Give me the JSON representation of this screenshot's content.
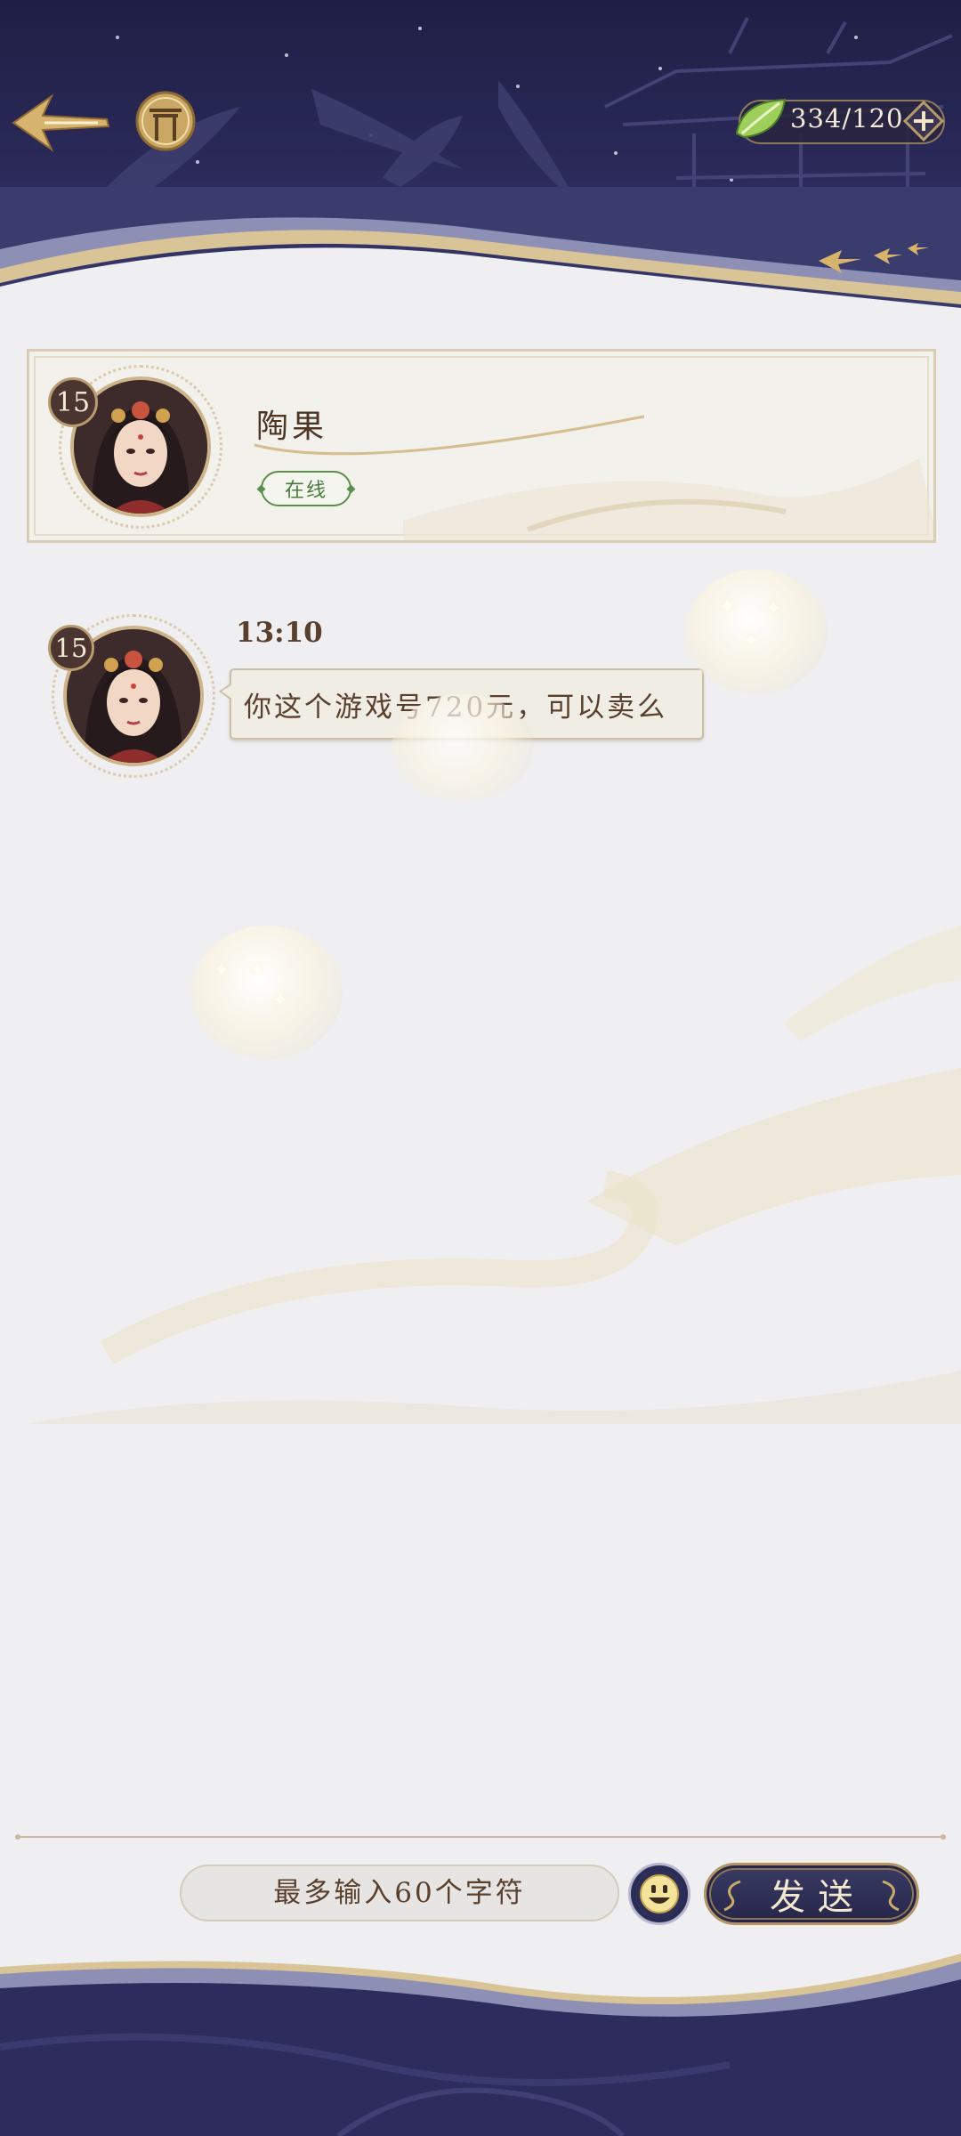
{
  "header": {
    "currency": {
      "icon": "leaf-icon",
      "value": "334/120",
      "add_icon": "plus-icon"
    },
    "back_icon": "back-arrow-icon",
    "gate_icon": "gate-icon"
  },
  "contact": {
    "name": "陶果",
    "status": "在线",
    "level": "15"
  },
  "messages": [
    {
      "time": "13:10",
      "level": "15",
      "text": "你这个游戏号720元，可以卖么"
    }
  ],
  "input": {
    "placeholder": "最多输入60个字符",
    "value": ""
  },
  "actions": {
    "emoji_icon": "smile-emoji-icon",
    "send_label": "发送"
  },
  "colors": {
    "banner_dark": "#2b2a5a",
    "gold": "#c9a96a",
    "online_green": "#4b7a3c",
    "text_brown": "#5a3f2c",
    "background": "#efeff1"
  }
}
